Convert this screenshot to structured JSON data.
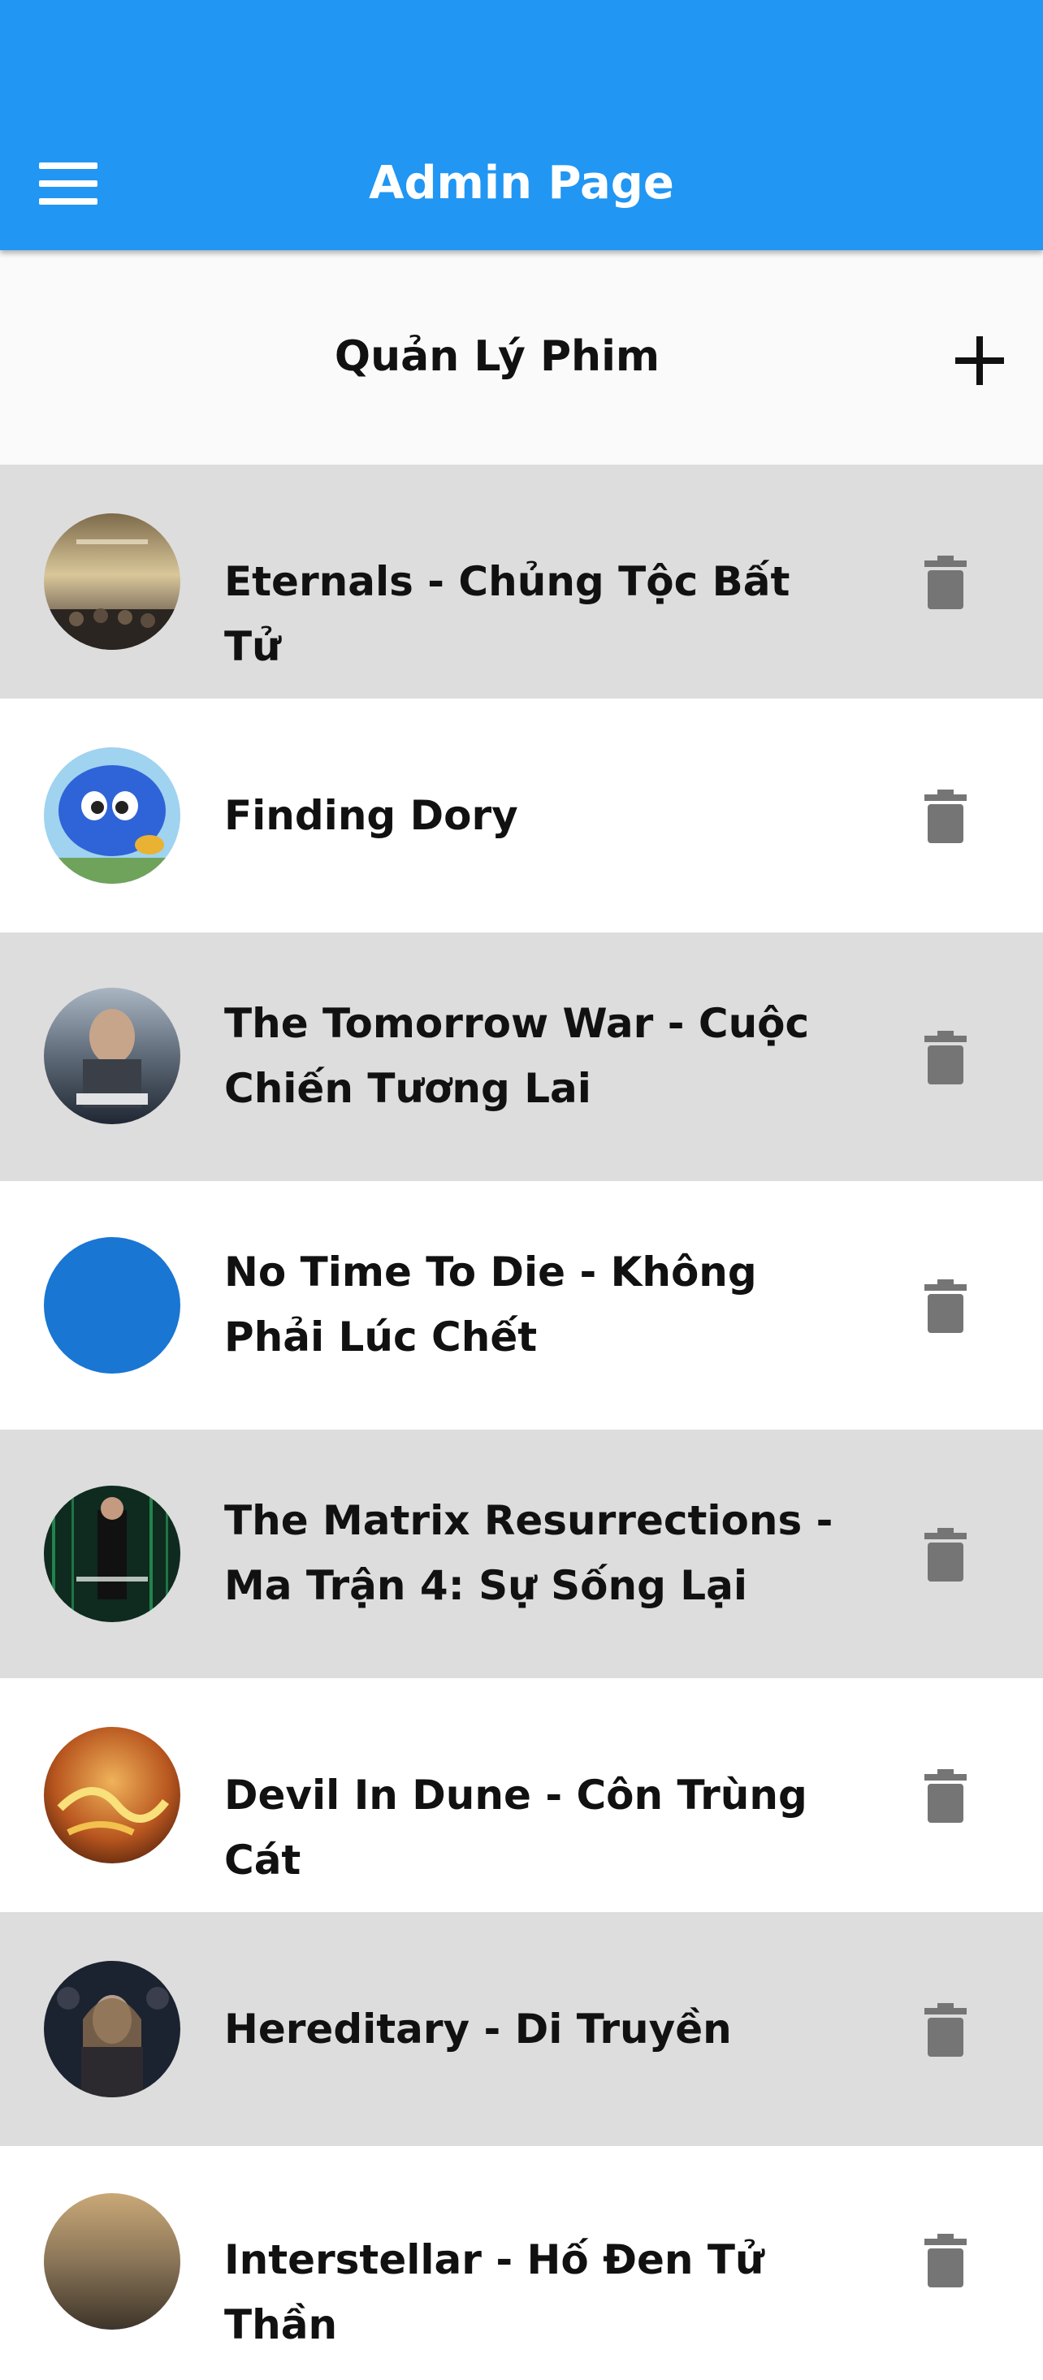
{
  "app_bar": {
    "title": "Admin Page",
    "menu_icon": "menu-icon",
    "color": "#2196F3"
  },
  "section": {
    "title": "Quản Lý Phim",
    "add_icon": "add-icon"
  },
  "movies": [
    {
      "title": "Eternals - Chủng Tộc Bất Tử",
      "poster": "eternals-poster"
    },
    {
      "title": "Finding Dory",
      "poster": "finding-dory-poster"
    },
    {
      "title": "The Tomorrow War - Cuộc Chiến Tương Lai",
      "poster": "tomorrow-war-poster"
    },
    {
      "title": "No Time To Die - Không Phải Lúc Chết",
      "poster": "blue-placeholder-poster"
    },
    {
      "title": "The Matrix Resurrections - Ma Trận 4: Sự Sống Lại",
      "poster": "matrix-poster"
    },
    {
      "title": "Devil In Dune - Côn Trùng Cát",
      "poster": "devil-in-dune-poster"
    },
    {
      "title": "Hereditary - Di Truyền",
      "poster": "hereditary-poster"
    },
    {
      "title": "Interstellar - Hố Đen Tử Thần",
      "poster": "interstellar-poster"
    }
  ],
  "colors": {
    "row_alt": "#dddddd",
    "row": "#ffffff",
    "delete_icon": "#757575"
  },
  "delete_icon": "trash-icon"
}
